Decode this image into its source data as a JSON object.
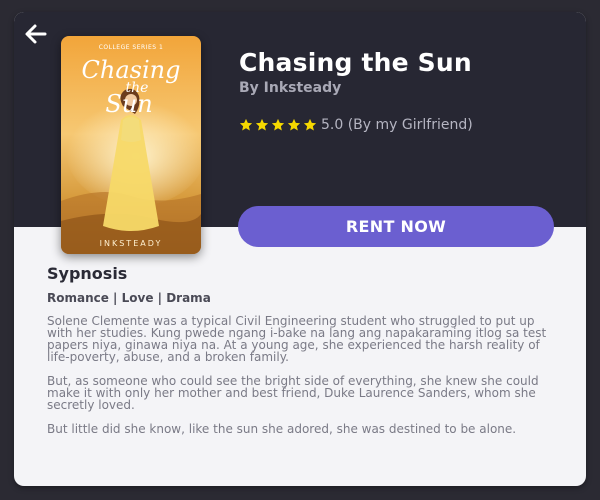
{
  "book": {
    "title": "Chasing the Sun",
    "author": "By Inksteady",
    "stars": 5,
    "rating_text": "5.0 (By my Girlfriend)",
    "cover": {
      "series": "COLLEGE SERIES 1",
      "title_line1": "Chasing",
      "title_line2": "the",
      "title_line3": "Sun",
      "author": "INKSTEADY"
    }
  },
  "actions": {
    "rent_label": "RENT NOW"
  },
  "synopsis": {
    "heading": "Sypnosis",
    "genres": "Romance | Love | Drama",
    "paragraphs": [
      "Solene Clemente was a typical Civil Engineering student who struggled to put up with her studies. Kung pwede ngang i-bake na lang ang napakaraming itlog sa test papers niya, ginawa niya na. At a young age, she experienced the harsh reality of life-poverty, abuse, and a broken family.",
      "But, as someone who could see the bright side of everything, she knew she could make it with only her mother and best friend, Duke Laurence Sanders, whom she secretly loved.",
      "But little did she know, like the sun she adored, she was destined to be alone."
    ]
  },
  "icons": {
    "back": "arrow-left-icon",
    "star": "star-icon"
  },
  "colors": {
    "background": "#2b2a33",
    "header": "#272733",
    "accent": "#6b5fd0",
    "star": "#f5d800"
  }
}
